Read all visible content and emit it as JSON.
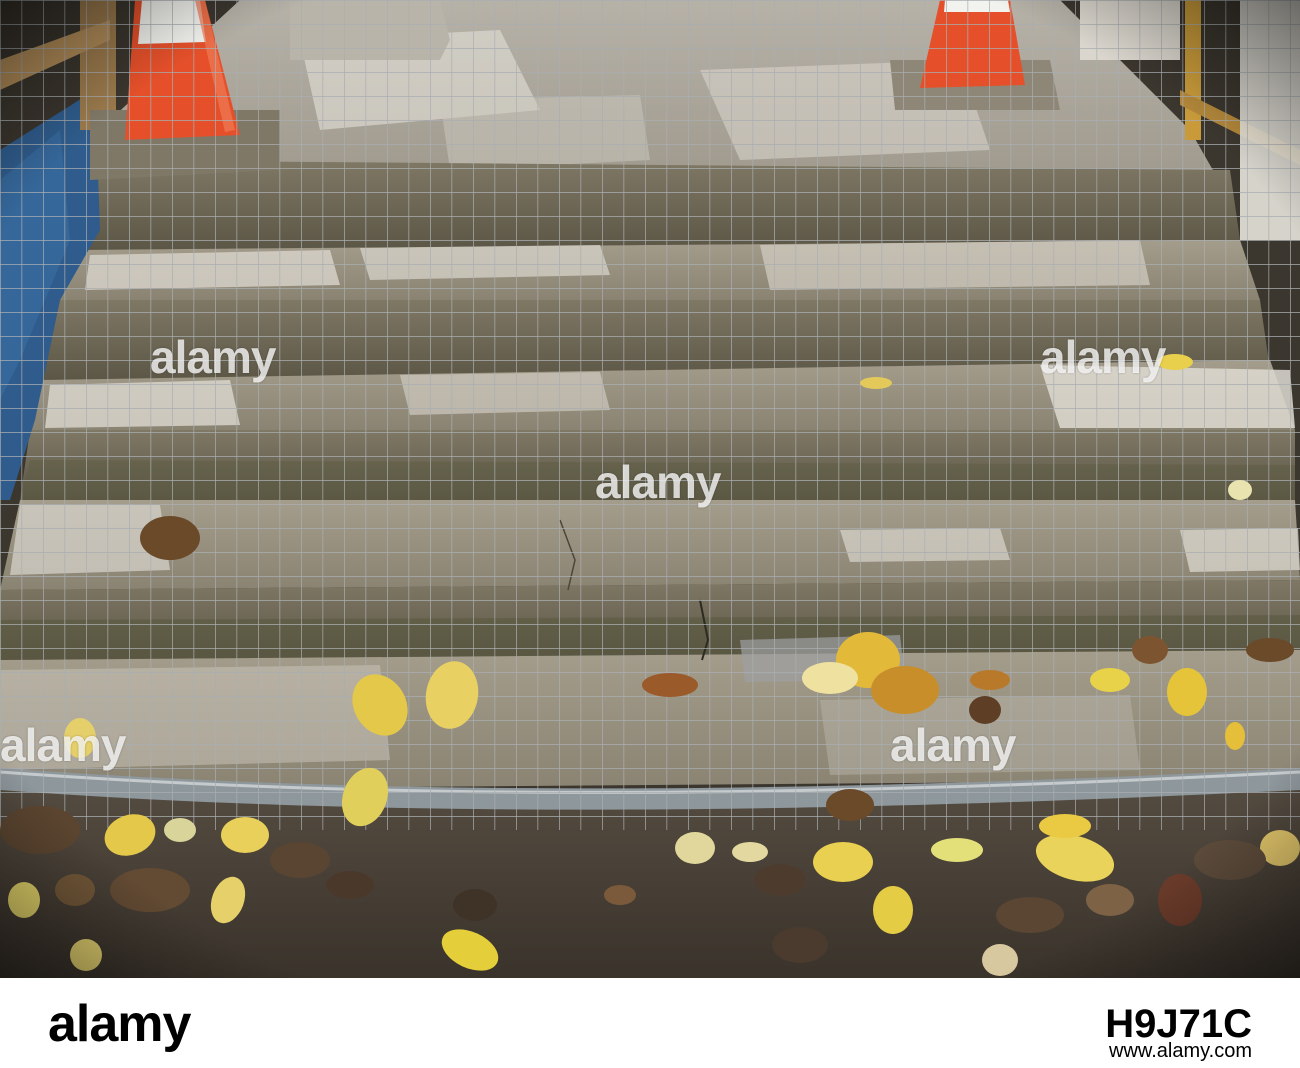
{
  "watermark": {
    "text": "alamy"
  },
  "footer": {
    "brand": "alamy",
    "image_id": "H9J71C",
    "url": "www.alamy.com"
  },
  "colors": {
    "stone": "#8f8876",
    "stone_light": "#cfcbc3",
    "cone_orange": "#e5502a",
    "cone_white": "#f2f2ee",
    "tarp_blue": "#2f5c8c",
    "fence_wire": "#9aa0a3",
    "leaf_yellow": "#e4c84a",
    "leaf_brown": "#6b4a2a",
    "pavement": "#4a4238"
  },
  "scene_elements": [
    "construction-fence",
    "traffic-cone",
    "blue-tarp",
    "stone-steps",
    "autumn-leaves",
    "scaffold-pole"
  ]
}
